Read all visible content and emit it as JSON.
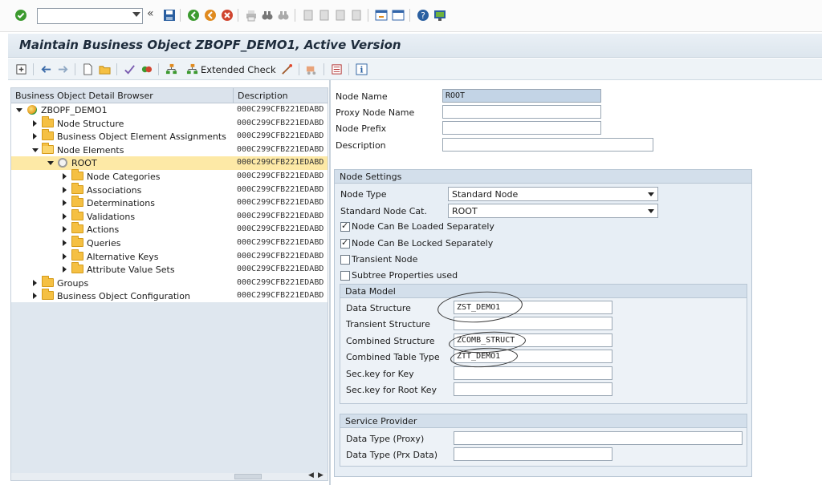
{
  "window": {
    "title": "Maintain Business Object ZBOPF_DEMO1, Active Version",
    "command_field": ""
  },
  "app_toolbar": {
    "extended_check_label": "Extended Check"
  },
  "tree": {
    "header_col1": "Business Object Detail Browser",
    "header_col2": "Description",
    "rows": [
      {
        "label": "ZBOPF_DEMO1",
        "desc": "000C299CFB221EDABD"
      },
      {
        "label": "Node Structure",
        "desc": "000C299CFB221EDABD"
      },
      {
        "label": "Business Object Element Assignments",
        "desc": "000C299CFB221EDABD"
      },
      {
        "label": "Node Elements",
        "desc": "000C299CFB221EDABD"
      },
      {
        "label": "ROOT",
        "desc": "000C299CFB221EDABD"
      },
      {
        "label": "Node Categories",
        "desc": "000C299CFB221EDABD"
      },
      {
        "label": "Associations",
        "desc": "000C299CFB221EDABD"
      },
      {
        "label": "Determinations",
        "desc": "000C299CFB221EDABD"
      },
      {
        "label": "Validations",
        "desc": "000C299CFB221EDABD"
      },
      {
        "label": "Actions",
        "desc": "000C299CFB221EDABD"
      },
      {
        "label": "Queries",
        "desc": "000C299CFB221EDABD"
      },
      {
        "label": "Alternative Keys",
        "desc": "000C299CFB221EDABD"
      },
      {
        "label": "Attribute Value Sets",
        "desc": "000C299CFB221EDABD"
      },
      {
        "label": "Groups",
        "desc": "000C299CFB221EDABD"
      },
      {
        "label": "Business Object Configuration",
        "desc": "000C299CFB221EDABD"
      }
    ]
  },
  "form": {
    "node_name_label": "Node Name",
    "node_name_value": "ROOT",
    "proxy_node_name_label": "Proxy Node Name",
    "proxy_node_name_value": "",
    "node_prefix_label": "Node Prefix",
    "node_prefix_value": "",
    "description_label": "Description",
    "description_value": ""
  },
  "node_settings": {
    "title": "Node Settings",
    "node_type_label": "Node Type",
    "node_type_value": "Standard Node",
    "std_node_cat_label": "Standard Node Cat.",
    "std_node_cat_value": "ROOT",
    "chk_loaded_label": "Node Can Be Loaded Separately",
    "chk_loaded": true,
    "chk_locked_label": "Node Can Be Locked Separately",
    "chk_locked": true,
    "chk_transient_label": "Transient Node",
    "chk_transient": false,
    "chk_subtree_label": "Subtree Properties used",
    "chk_subtree": false
  },
  "data_model": {
    "title": "Data Model",
    "data_structure_label": "Data Structure",
    "data_structure_value": "ZST_DEMO1",
    "transient_structure_label": "Transient Structure",
    "transient_structure_value": "",
    "combined_structure_label": "Combined Structure",
    "combined_structure_value": "ZCOMB_STRUCT",
    "combined_table_type_label": "Combined Table Type",
    "combined_table_type_value": "ZTT_DEMO1",
    "sec_key_label": "Sec.key for Key",
    "sec_key_value": "",
    "sec_key_root_label": "Sec.key for Root Key",
    "sec_key_root_value": ""
  },
  "service_provider": {
    "title": "Service Provider",
    "dt_proxy_label": "Data Type (Proxy)",
    "dt_proxy_value": "",
    "dt_prx_data_label": "Data Type (Prx Data)",
    "dt_prx_data_value": ""
  },
  "colors": {
    "selection": "#fde9a6",
    "highlight_field": "#c3d4e6",
    "title_text": "#1e2c3c"
  }
}
